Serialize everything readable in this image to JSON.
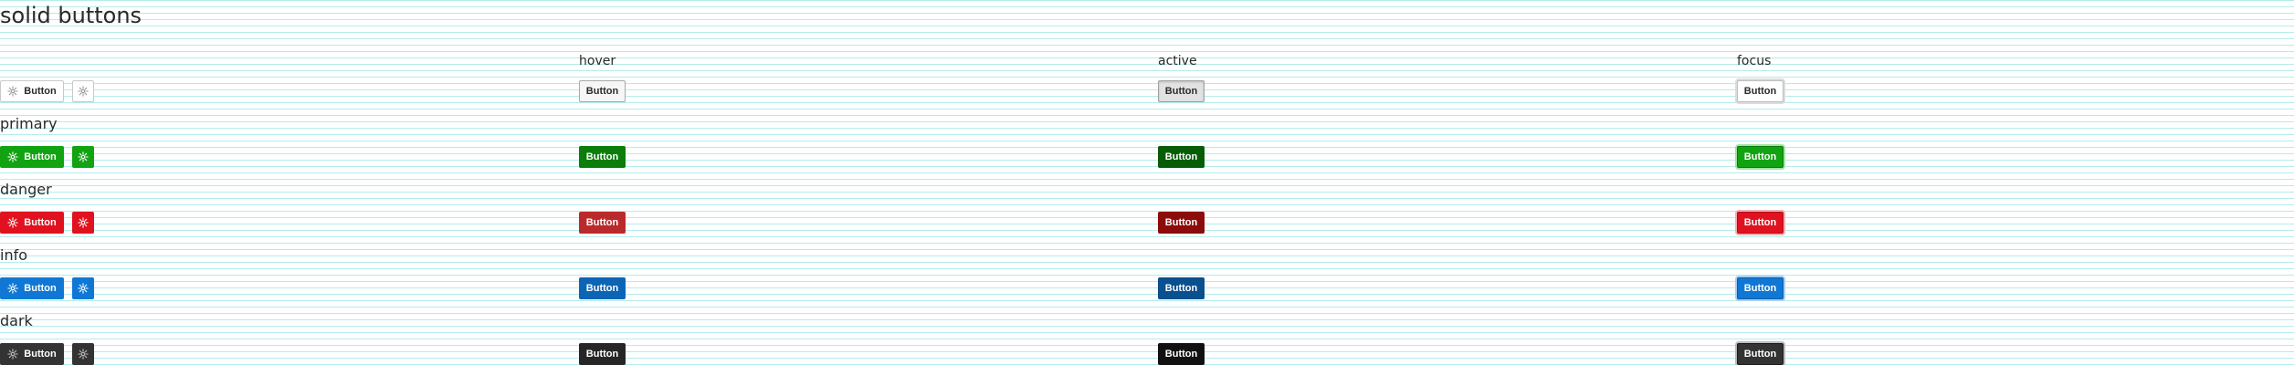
{
  "page": {
    "title": "solid buttons"
  },
  "columns": {
    "hover": "hover",
    "active": "active",
    "focus": "focus"
  },
  "button_label": "Button",
  "button_icon": "flower-icon",
  "sections": [
    {
      "key": "solid",
      "title": "",
      "colors": {
        "background": "#ffffff",
        "border": "#c9c9c9",
        "text": "#2b2b2b"
      }
    },
    {
      "key": "primary",
      "title": "primary",
      "colors": {
        "background": "#12a312",
        "hover": "#0a7d0a",
        "active": "#075d07",
        "text": "#ffffff"
      }
    },
    {
      "key": "danger",
      "title": "danger",
      "colors": {
        "background": "#e0121f",
        "hover": "#bb2a2a",
        "active": "#8c0b0b",
        "text": "#ffffff"
      }
    },
    {
      "key": "info",
      "title": "info",
      "colors": {
        "background": "#1078d4",
        "hover": "#0c64b4",
        "active": "#0a4f8e",
        "text": "#ffffff"
      }
    },
    {
      "key": "dark",
      "title": "dark",
      "colors": {
        "background": "#333333",
        "hover": "#262626",
        "active": "#111111",
        "text": "#ffffff"
      }
    }
  ]
}
